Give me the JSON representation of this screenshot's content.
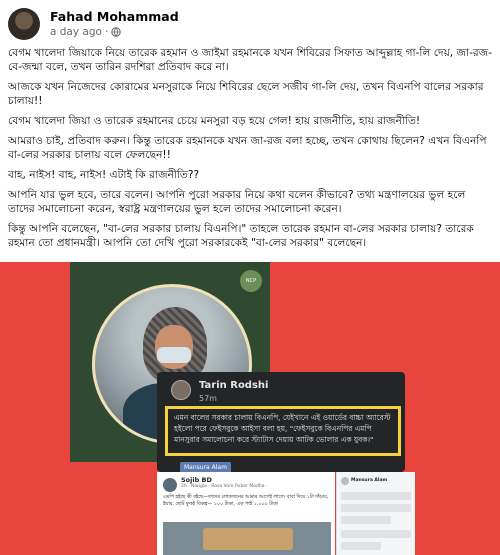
{
  "post": {
    "author": "Fahad Mohammad",
    "time": "a day ago",
    "separator": "·",
    "icons": [
      "avatar",
      "globe-icon"
    ],
    "paragraphs": [
      "বেগম খালেদা জিয়াকে নিয়ে তারেক রহমান ও জাইমা রহমানকে যখন শিবিরের সিফাত আব্দুল্লাহ গা-লি দেয়, জা-রজ-বে-জন্মা বলে, তখন তারিন রদশিরা প্রতিবাদ করে না।",
      "আজকে যখন নিজেদের কোরামের মনসুরাকে নিয়ে শিবিরের ছেলে সজীব গা-লি দেয়, তখন বিএনপি বালের সরকার চালায়!!",
      "বেগম খালেদা জিয়া ও তারেক রহমানের চেয়ে মনসুরা বড় হয়ে গেল! হায় রাজনীতি, হায় রাজনীতি!",
      "আমরাও চাই, প্রতিবাদ করুন। কিন্তু তারেক রহমানকে যখন জা-রজ বলা হচ্ছে, তখন কোথায় ছিলেন? এখন বিএনপি বা-লের সরকার চালায় বলে ফেলছেন!!",
      "বাহ, নাইস! বাহ, নাইস! এটাই কি রাজনীতি??",
      "আপনি যার ভুল হবে, তারে বলেন। আপনি পুরো সরকার নিয়ে কথা বলেন কীভাবে? তথ্য মন্ত্রণালয়ের ভুল হলে তাদের সমালোচনা করেন, স্বরাষ্ট্র মন্ত্রণালয়ের ভুল হলে তাদের সমালোচনা করেন।",
      "কিন্তু আপনি বলেছেন, \"বা-লের সরকার চালায় বিএনপি।\" তাহলে তারেক রহমান বা-লের সরকার চালায়? তারেক রহমান তো প্রধানমন্ত্রী। আপনি তো দেখি পুরো সরকারকেই \"বা-লের সরকার\" বলেছেন।"
    ]
  },
  "image": {
    "background_color": "#e9453f",
    "left_photo_logo": "NCP",
    "dark_card": {
      "name": "Tarin Rodshi",
      "time": "57m",
      "quote": "এমন বালের সরকার চালায় বিএনপি, যেইখানে এই ওয়ার্ডের বাচ্চা অ্যারেস্ট হইলো পরে ফেইসবুকে আইসা বলা হয়, \"ফেইসবুকে বিএনপির এমপি মানসুরার সমালোচনা করে স্ট্যাটাস দেয়ায় আটক ভোলার এক যুবক।\""
    },
    "tag": "Mansura Alam",
    "fb_post": {
      "name": "Sojib BD",
      "sub": "2h · Nangla - Rosa Vore Puber Modha ·",
      "text": "এমপি হইছে কী বইছে—তাদের লোকজনের আমার আগেই লাগে। বাবা দিয়ে ১টা দাঁড়ায়, ইয়ার, ছোট ফুকই বিকল্প— ১০০ টাকা, এক পাই ১,০০০ টাকা"
    },
    "mini_panel": {
      "title": "Mansura Alam"
    }
  },
  "colors": {
    "text": "#050505",
    "muted": "#65676b",
    "highlight_border": "#f4d13d",
    "dark_card": "#242526"
  }
}
